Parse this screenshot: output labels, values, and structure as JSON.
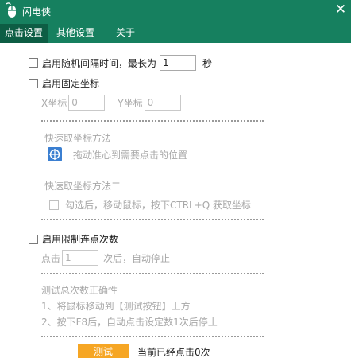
{
  "window": {
    "title": "闪电侠",
    "close_glyph": "✕"
  },
  "tabs": [
    {
      "label": "点击设置",
      "active": true
    },
    {
      "label": "其他设置",
      "active": false
    },
    {
      "label": "关于",
      "active": false
    }
  ],
  "random_interval": {
    "checkbox_label": "启用随机间隔时间，最长为",
    "value": "1",
    "unit": "秒",
    "checked": false
  },
  "fixed_coords": {
    "checkbox_label": "启用固定坐标",
    "checked": false,
    "x_label": "X坐标",
    "x_value": "0",
    "y_label": "Y坐标",
    "y_value": "0",
    "method1_title": "快速取坐标方法一",
    "method1_hint": "拖动准心到需要点击的位置",
    "method2_title": "快速取坐标方法二",
    "method2_checkbox_label": "勾选后，移动鼠标，按下CTRL+Q 获取坐标"
  },
  "limit_clicks": {
    "checkbox_label": "启用限制连点次数",
    "checked": false,
    "prefix": "点击",
    "value": "1",
    "suffix": "次后，自动停止",
    "test_title": "测试总次数正确性",
    "step1": "1、将鼠标移动到【测试按钮】上方",
    "step2": "2、按下F8后，自动点击设定数1次后停止",
    "test_button": "测试",
    "status": "当前已经点击0次"
  },
  "colors": {
    "titlebar": "#16805f",
    "active_tab": "#0d5d44",
    "test_button": "#f6a624"
  },
  "icons": [
    "app-mouse-icon",
    "close-icon",
    "crosshair-target-icon"
  ]
}
